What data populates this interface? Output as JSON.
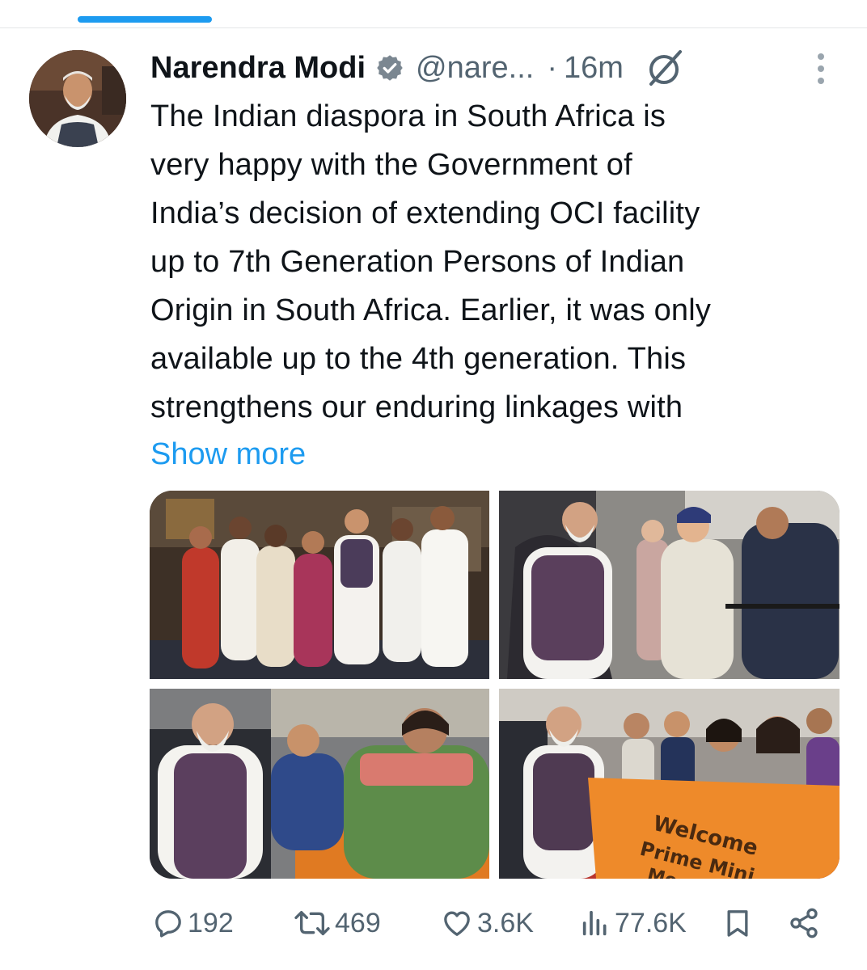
{
  "tweet": {
    "author_name": "Narendra Modi",
    "author_handle": "@nare...",
    "separator": "·",
    "time_ago": "16m",
    "text_lines": [
      "The Indian diaspora in South Africa is",
      "very happy with the Government of",
      "India’s decision of extending OCI facility",
      "up to 7th Generation Persons of Indian",
      "Origin in South Africa. Earlier, it was only",
      "available up to the 4th generation. This",
      "strengthens our enduring linkages with"
    ],
    "show_more_label": "Show more",
    "photos": [
      {
        "description_icon": "photo-group-portrait"
      },
      {
        "description_icon": "photo-greeting"
      },
      {
        "description_icon": "photo-namaste-crowd"
      },
      {
        "description_icon": "photo-welcome-banner"
      }
    ],
    "banner_text_1": "Welcome",
    "banner_text_2": "Prime Mini",
    "banner_text_3": "Mo",
    "actions": {
      "replies": "192",
      "reposts": "469",
      "likes": "3.6K",
      "views": "77.6K"
    }
  },
  "colors": {
    "accent": "#1d9bf0",
    "secondary_text": "#536471",
    "verified_badge": "#7b8791"
  }
}
